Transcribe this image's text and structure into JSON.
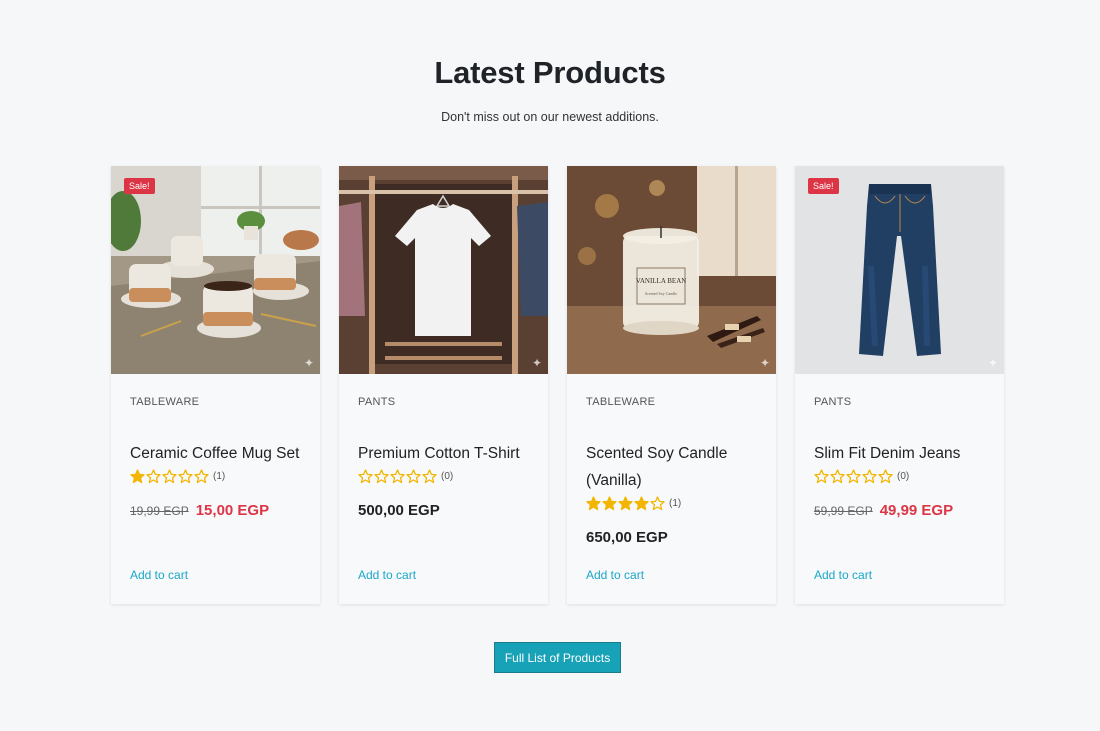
{
  "section": {
    "title": "Latest Products",
    "subtitle": "Don't miss out on our newest additions."
  },
  "products": [
    {
      "category": "TABLEWARE",
      "name": "Ceramic Coffee Mug Set",
      "rating": 1,
      "review_count": "(1)",
      "sale_badge": "Sale!",
      "old_price": "19,99 EGP",
      "price": "15,00 EGP",
      "add_to_cart": "Add to cart"
    },
    {
      "category": "PANTS",
      "name": "Premium Cotton T-Shirt",
      "rating": 0,
      "review_count": "(0)",
      "price": "500,00 EGP",
      "add_to_cart": "Add to cart"
    },
    {
      "category": "TABLEWARE",
      "name": "Scented Soy Candle (Vanilla)",
      "rating": 4,
      "review_count": "(1)",
      "price": "650,00 EGP",
      "add_to_cart": "Add to cart",
      "image_label_1": "VANILLA BEAN",
      "image_label_2": "Scented Soy Candle"
    },
    {
      "category": "PANTS",
      "name": "Slim Fit Denim Jeans",
      "rating": 0,
      "review_count": "(0)",
      "sale_badge": "Sale!",
      "old_price": "59,99 EGP",
      "price": "49,99 EGP",
      "add_to_cart": "Add to cart"
    }
  ],
  "full_list_button": "Full List of Products",
  "colors": {
    "accent": "#17a2b8",
    "link": "#1aa7c9",
    "sale": "#dc3545",
    "star": "#f2b600"
  }
}
